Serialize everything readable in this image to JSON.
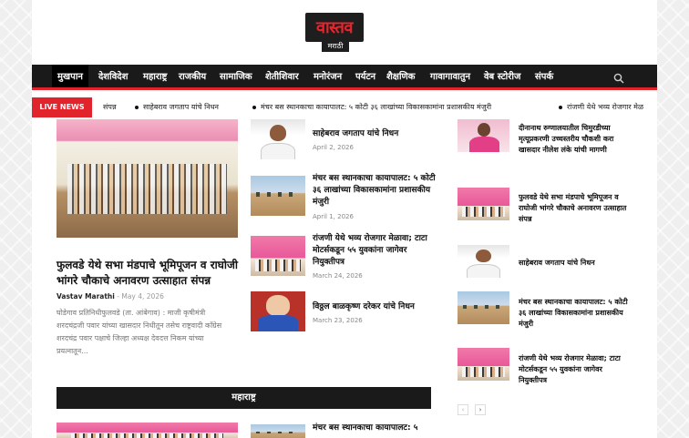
{
  "logo": {
    "wordmark": "वास्तव",
    "sub": "मराठी"
  },
  "nav": {
    "items": [
      "मुखपान",
      "देशविदेश",
      "महाराष्ट्र",
      "राजकीय",
      "सामाजिक",
      "शेतीशिवार",
      "मनोरंजन",
      "पर्यटन",
      "शैक्षणिक",
      "गावागावातुन",
      "वेब स्टोरीज",
      "संपर्क"
    ]
  },
  "ticker": {
    "label": "LIVE NEWS",
    "items": [
      "संपन्न",
      "साहेबराव जगताप यांचे निधन",
      "मंचर बस स्थानकाचा कायापालट: ५ कोटी ३६ लाखांच्या विकासकामांना प्रशासकीय मंजुरी",
      "रांजणी येथे भव्य रोजगार मेळ"
    ]
  },
  "lead": {
    "title": "फुलवडे येथे सभा मंडपाचे भूमिपूजन व राघोजी भांगरे चौकाचे अनावरण उत्साहात संपन्न",
    "author": "Vastav Marathi",
    "sep": "-",
    "date": "May 4, 2026",
    "excerpt": "घोडेगाव प्रतिनिधीफुलवडे (ता. आंबेगाव) : माजी कृषीमंत्री शरदचंद्रजी पवार यांच्या खासदार निधीतून तसेच राष्ट्रवादी कॉंग्रेस शरदचंद्र पवार पक्षाचे जिल्हा अध्यक्ष देवदत्त निकम यांच्या प्रयत्नातून..."
  },
  "middle": [
    {
      "title": "साहेबराव जगताप यांचे निधन",
      "date": "April 2, 2026"
    },
    {
      "title": "मंचर बस स्थानकाचा कायापालट: ५ कोटी ३६ लाखांच्या विकासकामांना प्रशासकीय मंजुरी",
      "date": "April 1, 2026"
    },
    {
      "title": "रांजणी येथे भव्य रोजगार मेळावा; टाटा मोटर्सकडून ५५ युवकांना जागेवर नियुक्तीपत्र",
      "date": "March 24, 2026"
    },
    {
      "title": "विठ्ठल बाळकृष्ण दरेकर यांचे निधन",
      "date": "March 23, 2026"
    }
  ],
  "right": [
    {
      "title": "दीनानाथ रुग्णालयातील चिमुरडीच्या मृत्यूप्रकरणी उच्चस्तरीय चौकशी करा खासदार नीलेश लंके यांची मागणी"
    },
    {
      "title": "फुलवडे येथे सभा मंडपाचे भूमिपूजन व राघोजी भांगरे चौकाचे अनावरण उत्साहात संपन्न"
    },
    {
      "title": "साहेबराव जगताप यांचे निधन"
    },
    {
      "title": "मंचर बस स्थानकाचा कायापालट: ५ कोटी ३६ लाखांच्या विकासकामांना प्रशासकीय मंजुरी"
    },
    {
      "title": "रांजणी येथे भव्य रोजगार मेळावा; टाटा मोटर्सकडून ५५ युवकांना जागेवर नियुक्तीपत्र"
    }
  ],
  "section": {
    "title": "महाराष्ट्र"
  },
  "bottom_peek": {
    "title": "मंचर बस स्थानकाचा कायापालट: ५"
  },
  "pager": {
    "prev": "‹",
    "next": "›"
  },
  "colors": {
    "accent": "#e1242c",
    "nav_bg": "#1a1a1a"
  }
}
